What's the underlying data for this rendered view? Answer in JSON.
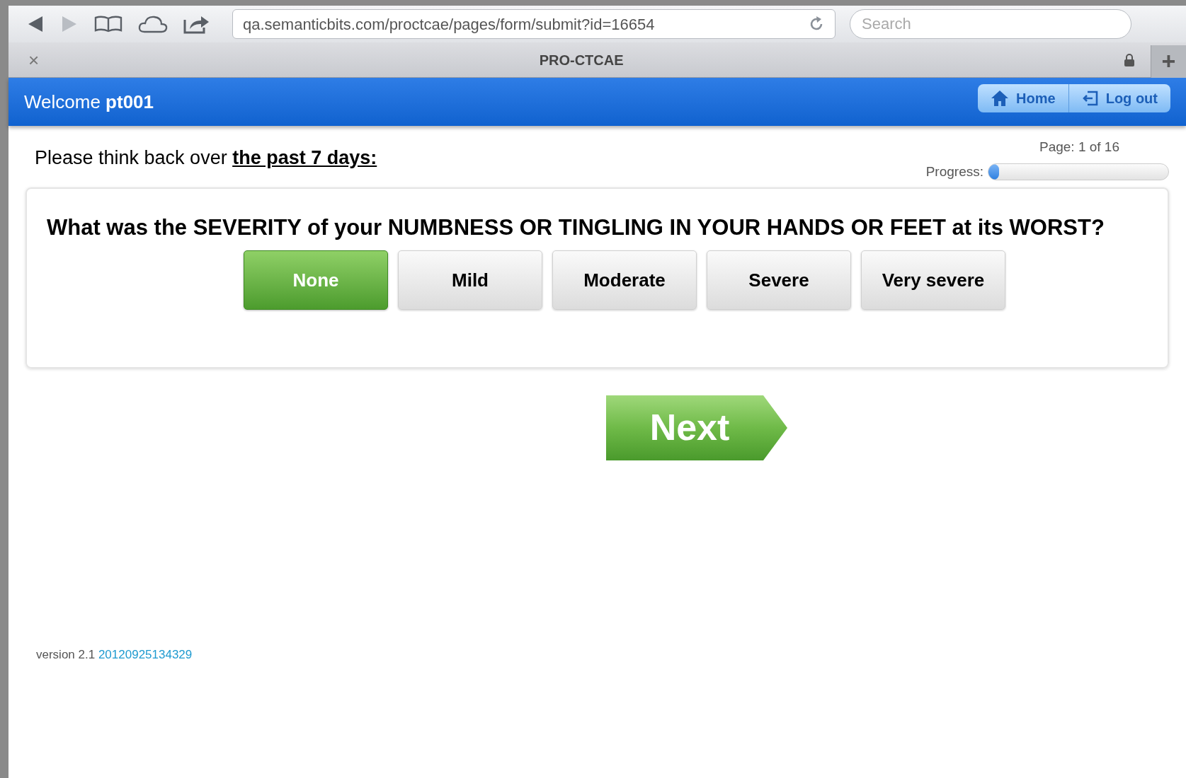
{
  "browser": {
    "url": "qa.semanticbits.com/proctcae/pages/form/submit?id=16654",
    "search": {
      "placeholder": "Search"
    },
    "tab_title": "PRO-CTCAE",
    "tab_close": "×",
    "new_tab": "+"
  },
  "header": {
    "welcome": "Welcome **pt001**",
    "buttons": [
      {
        "kind": "home",
        "label": "Home"
      },
      {
        "kind": "logout",
        "label": "Log out"
      }
    ]
  },
  "page_indicator": "Page: 1 of 16",
  "progress": {
    "label": "Progress:",
    "level": 0.06
  },
  "instruction": "Please think back over **the past 7 days:**",
  "question": "What was the SEVERITY of your NUMBNESS OR TINGLING IN YOUR HANDS OR FEET at its WORST?",
  "answers": [
    {
      "label": "None",
      "selected": true
    },
    {
      "label": "Mild",
      "selected": false
    },
    {
      "label": "Moderate",
      "selected": false
    },
    {
      "label": "Severe",
      "selected": false
    },
    {
      "label": "Very severe",
      "selected": false
    }
  ],
  "next_button": "Next",
  "footer": {
    "version": "version 2.1",
    "build": "20120925134329"
  }
}
